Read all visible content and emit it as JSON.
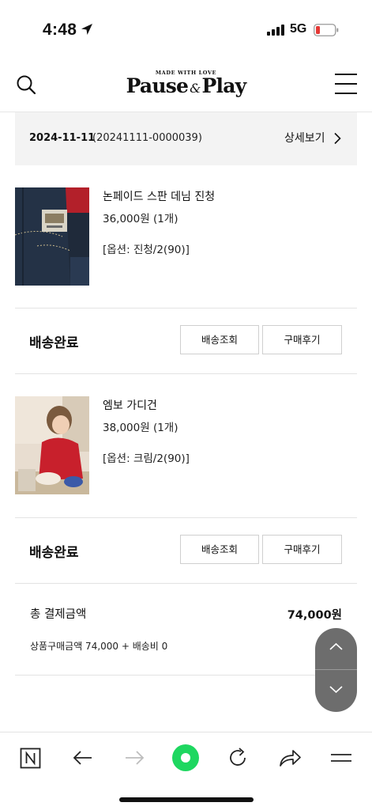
{
  "status_bar": {
    "time": "4:48",
    "network": "5G"
  },
  "header": {
    "logo_small": "MADE WITH LOVE",
    "logo_left": "Pause",
    "logo_amp": "&",
    "logo_right": "Play"
  },
  "order": {
    "date": "2024-11-11",
    "number": "(20241111-0000039)",
    "detail_label": "상세보기"
  },
  "items": [
    {
      "name": "논페이드 스판 데님 진청",
      "price": "36,000원 (1개)",
      "option": "[옵션: 진청/2(90)]",
      "status": "배송완료",
      "track_label": "배송조회",
      "review_label": "구매후기"
    },
    {
      "name": "엠보 가디건",
      "price": "38,000원 (1개)",
      "option": "[옵션: 크림/2(90)]",
      "status": "배송완료",
      "track_label": "배송조회",
      "review_label": "구매후기"
    }
  ],
  "totals": {
    "label": "총 결제금액",
    "value": "74,000원",
    "breakdown": "상품구매금액 74,000 + 배송비 0"
  },
  "colors": {
    "accent_green": "#1ed760",
    "battery_low": "#e53935"
  },
  "icons": {
    "search": "search-icon",
    "menu": "hamburger-icon",
    "chevron": "chevron-right-icon",
    "toolbar": [
      "naver-n-icon",
      "back-arrow-icon",
      "forward-arrow-icon",
      "green-dot-icon",
      "reload-icon",
      "share-icon",
      "menu-icon"
    ]
  }
}
